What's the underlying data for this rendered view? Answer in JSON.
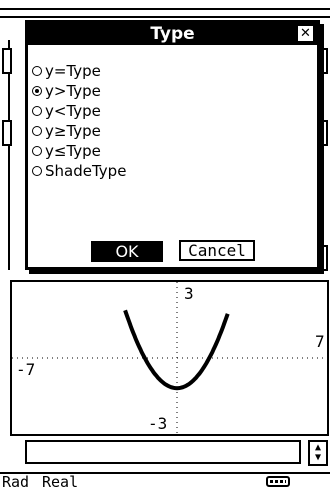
{
  "dialog": {
    "title": "Type",
    "close_symbol": "✕",
    "options": [
      {
        "label": "y=Type",
        "selected": false
      },
      {
        "label": "y>Type",
        "selected": true
      },
      {
        "label": "y<Type",
        "selected": false
      },
      {
        "label": "y≥Type",
        "selected": false
      },
      {
        "label": "y≤Type",
        "selected": false
      },
      {
        "label": "ShadeType",
        "selected": false
      }
    ],
    "ok_label": "OK",
    "cancel_label": "Cancel"
  },
  "graph": {
    "x_min_label": "-7",
    "x_max_label": "7",
    "y_max_label": "3",
    "y_min_label": "-3"
  },
  "status_bar": {
    "angle_mode": "Rad",
    "number_mode": "Real",
    "battery_icon": "battery-icon"
  },
  "stepper": {
    "up_icon": "triangle-up-icon",
    "down_icon": "triangle-down-icon"
  }
}
